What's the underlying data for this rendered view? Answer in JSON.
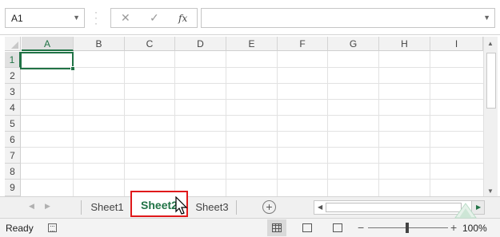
{
  "formula_bar": {
    "name_box_value": "A1",
    "cancel_icon": "cancel-icon",
    "enter_icon": "check-icon",
    "function_label": "fx",
    "formula_value": ""
  },
  "columns": [
    "A",
    "B",
    "C",
    "D",
    "E",
    "F",
    "G",
    "H",
    "I"
  ],
  "rows": [
    "1",
    "2",
    "3",
    "4",
    "5",
    "6",
    "7",
    "8",
    "9"
  ],
  "selected_cell": "A1",
  "sheet_tabs": [
    {
      "label": "Sheet1",
      "active": false
    },
    {
      "label": "Sheet2",
      "active": true
    },
    {
      "label": "Sheet3",
      "active": false
    }
  ],
  "status_bar": {
    "status": "Ready",
    "zoom": "100%"
  },
  "colors": {
    "accent": "#217346",
    "highlight": "#e0191b"
  }
}
